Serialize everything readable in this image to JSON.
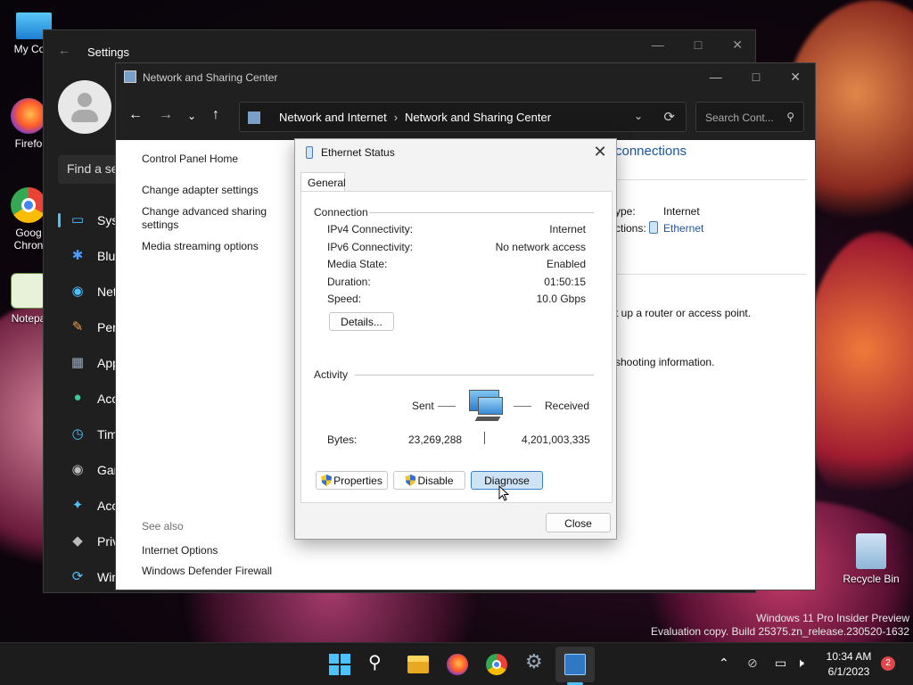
{
  "desktop": {
    "icons": [
      {
        "label": "My Com"
      },
      {
        "label": "Firefo"
      },
      {
        "label": "Goog",
        "label2": "Chron"
      },
      {
        "label": "Notepa"
      },
      {
        "label": "Recycle Bin"
      }
    ],
    "watermark": {
      "line1": "Windows 11 Pro Insider Preview",
      "line2": "Evaluation copy. Build 25375.zn_release.230520-1632"
    }
  },
  "settings_window": {
    "title": "Settings",
    "search_placeholder": "Find a se",
    "nav": [
      {
        "label": "Syst",
        "icon": "monitor-icon"
      },
      {
        "label": "Blue",
        "icon": "bluetooth-icon"
      },
      {
        "label": "Net",
        "icon": "wifi-icon"
      },
      {
        "label": "Pers",
        "icon": "brush-icon"
      },
      {
        "label": "App",
        "icon": "apps-icon"
      },
      {
        "label": "Acc",
        "icon": "person-icon"
      },
      {
        "label": "Tim",
        "icon": "clock-icon"
      },
      {
        "label": "Gar",
        "icon": "gamepad-icon"
      },
      {
        "label": "Acc",
        "icon": "accessibility-icon"
      },
      {
        "label": "Priv",
        "icon": "shield-icon"
      },
      {
        "label": "Win",
        "icon": "update-icon"
      }
    ]
  },
  "nsc_window": {
    "title": "Network and Sharing Center",
    "breadcrumb": [
      "Network and Internet",
      "Network and Sharing Center"
    ],
    "search_placeholder": "Search Cont...",
    "left_links": {
      "home": "Control Panel Home",
      "items": [
        "Change adapter settings",
        "Change advanced sharing settings",
        "Media streaming options"
      ]
    },
    "see_also": {
      "label": "See also",
      "links": [
        "Internet Options",
        "Windows Defender Firewall"
      ]
    },
    "right": {
      "heading_partial": "connections",
      "access_type_label": "ype:",
      "access_type_value": "Internet",
      "connections_label": "ctions:",
      "connections_value": "Ethernet",
      "router_text": "t up a router or access point.",
      "troubleshoot_text": "shooting information."
    }
  },
  "eth_dialog": {
    "title": "Ethernet Status",
    "tab": "General",
    "connection": {
      "header": "Connection",
      "rows": [
        {
          "label": "IPv4 Connectivity:",
          "value": "Internet"
        },
        {
          "label": "IPv6 Connectivity:",
          "value": "No network access"
        },
        {
          "label": "Media State:",
          "value": "Enabled"
        },
        {
          "label": "Duration:",
          "value": "01:50:15"
        },
        {
          "label": "Speed:",
          "value": "10.0 Gbps"
        }
      ],
      "details_button": "Details..."
    },
    "activity": {
      "header": "Activity",
      "sent_label": "Sent",
      "received_label": "Received",
      "bytes_label": "Bytes:",
      "bytes_sent": "23,269,288",
      "bytes_received": "4,201,003,335"
    },
    "buttons": {
      "properties": "Properties",
      "disable": "Disable",
      "diagnose": "Diagnose",
      "close": "Close"
    }
  },
  "taskbar": {
    "clock_time": "10:34 AM",
    "clock_date": "6/1/2023",
    "notification_count": "2"
  }
}
